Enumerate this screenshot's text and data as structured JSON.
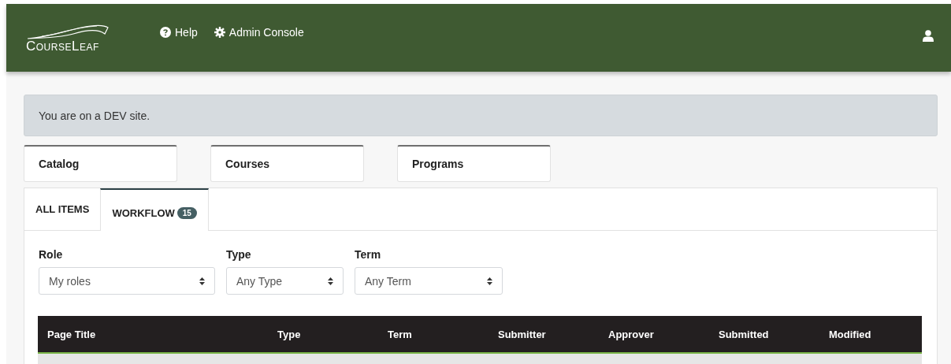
{
  "header": {
    "logo": "CourseLeaf",
    "links": [
      {
        "kind": "help",
        "label": "Help"
      },
      {
        "kind": "admin",
        "label": "Admin Console"
      }
    ]
  },
  "alert": "You are on a DEV site.",
  "sections": [
    {
      "label": "Catalog"
    },
    {
      "label": "Courses"
    },
    {
      "label": "Programs"
    }
  ],
  "tabs": [
    {
      "label": "ALL ITEMS",
      "selected": false
    },
    {
      "label": "WORKFLOW",
      "badge": "15",
      "selected": true
    }
  ],
  "filters": [
    {
      "label": "Role",
      "value": "My roles"
    },
    {
      "label": "Type",
      "value": "Any Type"
    },
    {
      "label": "Term",
      "value": "Any Term"
    }
  ],
  "table": {
    "columns": [
      "Page Title",
      "Type",
      "Term",
      "Submitter",
      "Approver",
      "Submitted",
      "Modified"
    ]
  }
}
